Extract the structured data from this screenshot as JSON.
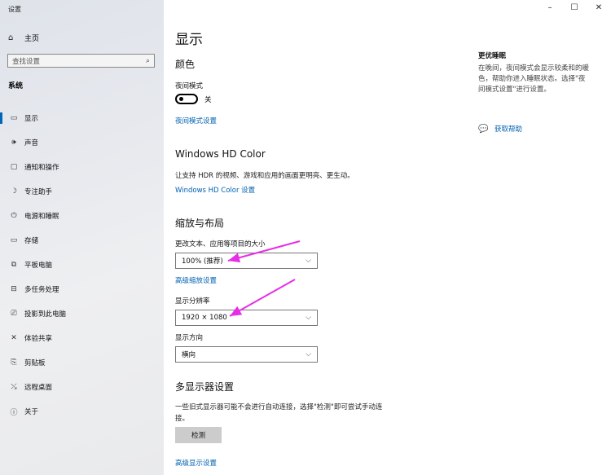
{
  "window": {
    "title": "设置",
    "minimize": "–",
    "maximize": "☐",
    "close": "✕"
  },
  "sidebar": {
    "home_icon": "home-icon",
    "home_label": "主页",
    "search_placeholder": "查找设置",
    "section_title": "系统",
    "items": [
      {
        "icon": "▭",
        "icon_name": "display-icon",
        "label": "显示",
        "active": true
      },
      {
        "icon": "🕪",
        "icon_name": "sound-icon",
        "label": "声音"
      },
      {
        "icon": "▢",
        "icon_name": "notifications-icon",
        "label": "通知和操作"
      },
      {
        "icon": "☽",
        "icon_name": "focus-assist-icon",
        "label": "专注助手"
      },
      {
        "icon": "⏻",
        "icon_name": "power-icon",
        "label": "电源和睡眠"
      },
      {
        "icon": "▭",
        "icon_name": "storage-icon",
        "label": "存储"
      },
      {
        "icon": "⧉",
        "icon_name": "tablet-icon",
        "label": "平板电脑"
      },
      {
        "icon": "⊟",
        "icon_name": "multitasking-icon",
        "label": "多任务处理"
      },
      {
        "icon": "⎚",
        "icon_name": "projecting-icon",
        "label": "投影到此电脑"
      },
      {
        "icon": "✕",
        "icon_name": "shared-experiences-icon",
        "label": "体验共享"
      },
      {
        "icon": "⎘",
        "icon_name": "clipboard-icon",
        "label": "剪贴板"
      },
      {
        "icon": "⤯",
        "icon_name": "remote-desktop-icon",
        "label": "远程桌面"
      },
      {
        "icon": "ⓘ",
        "icon_name": "about-icon",
        "label": "关于"
      }
    ]
  },
  "main": {
    "page_title": "显示",
    "color": {
      "heading": "颜色",
      "night_light_label": "夜间模式",
      "night_light_state": "关",
      "night_light_on": false,
      "night_light_settings_link": "夜间模式设置"
    },
    "hdr": {
      "heading": "Windows HD Color",
      "description": "让支持 HDR 的视频、游戏和应用的画面更明亮、更生动。",
      "settings_link": "Windows HD Color 设置"
    },
    "scale": {
      "heading": "缩放与布局",
      "text_size_label": "更改文本、应用等项目的大小",
      "text_size_value": "100% (推荐)",
      "advanced_scaling_link": "高级缩放设置",
      "resolution_label": "显示分辨率",
      "resolution_value": "1920 × 1080",
      "orientation_label": "显示方向",
      "orientation_value": "横向"
    },
    "multi_display": {
      "heading": "多显示器设置",
      "description_line1": "一些旧式显示器可能不会进行自动连接，选择\"检测\"即可尝试手动连",
      "description_line2": "接。",
      "detect_button": "检测",
      "advanced_display_link": "高级显示设置"
    }
  },
  "right_panel": {
    "title": "更优睡眠",
    "line1": "在晚间，夜间模式会显示较柔和的暖",
    "line2": "色，帮助你进入睡眠状态。选择\"夜",
    "line3": "间模式设置\"进行设置。",
    "help_icon": "get-help-icon",
    "help_label": "获取帮助"
  },
  "annotations": {
    "arrow_color": "#e62ee6"
  },
  "colors": {
    "accent": "#0067b8",
    "link": "#0060b0"
  }
}
